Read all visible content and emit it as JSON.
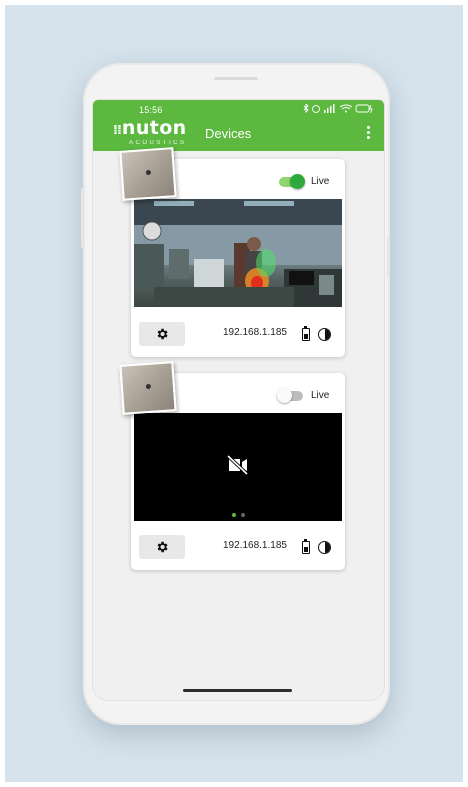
{
  "status_bar": {
    "time": "15:56"
  },
  "app_bar": {
    "logo_main": "nuton",
    "logo_sub": "ACOUSTICS",
    "title": "Devices"
  },
  "devices": [
    {
      "live_label": "Live",
      "live_on": true,
      "ip": "192.168.1.185",
      "feed_state": "streaming"
    },
    {
      "live_label": "Live",
      "live_on": false,
      "ip": "192.168.1.185",
      "feed_state": "camera-off"
    }
  ],
  "icons": {
    "overflow": "overflow-menu-icon",
    "settings": "gear-icon",
    "battery": "battery-icon",
    "contrast": "contrast-icon",
    "camera_off": "camera-off-icon"
  },
  "colors": {
    "accent": "#5cb83f",
    "toggle_on": "#2eaa3a"
  }
}
